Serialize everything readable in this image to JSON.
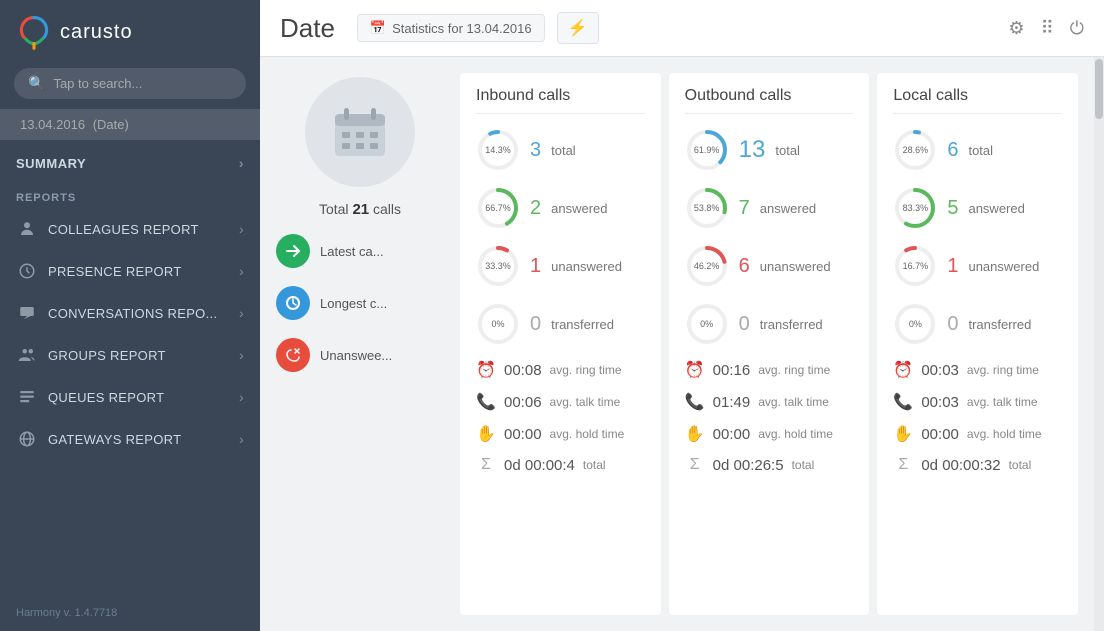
{
  "app": {
    "name": "carusto",
    "version": "Harmony v. 1.4.7718"
  },
  "sidebar": {
    "search_placeholder": "Tap to search...",
    "date_item": "13.04.2016",
    "date_label": "(Date)",
    "summary_label": "SUMMARY",
    "reports_label": "REPORTS",
    "nav_items": [
      {
        "id": "colleagues",
        "label": "COLLEAGUES REPORT",
        "icon": "person"
      },
      {
        "id": "presence",
        "label": "PRESENCE REPORT",
        "icon": "clock"
      },
      {
        "id": "conversations",
        "label": "CONVERSATIONS REPO...",
        "icon": "chat"
      },
      {
        "id": "groups",
        "label": "GROUPS REPORT",
        "icon": "groups"
      },
      {
        "id": "queues",
        "label": "QUEUES REPORT",
        "icon": "queues"
      },
      {
        "id": "gateways",
        "label": "GATEWAYS REPORT",
        "icon": "globe"
      }
    ]
  },
  "header": {
    "title": "Date",
    "stats_badge": "Statistics for 13.04.2016"
  },
  "left_panel": {
    "total_calls": "Total",
    "total_number": "21",
    "total_suffix": "calls",
    "items": [
      {
        "label": "Latest ca...",
        "color": "#27ae60",
        "bg": "#27ae60",
        "icon": "→"
      },
      {
        "label": "Longest c...",
        "color": "#3498db",
        "bg": "#3498db",
        "icon": "↺"
      },
      {
        "label": "Unanswee...",
        "color": "#e74c3c",
        "bg": "#e74c3c",
        "icon": "✗"
      }
    ]
  },
  "inbound": {
    "title": "Inbound calls",
    "total": {
      "pct": "14.3%",
      "value": "3",
      "label": "total",
      "color_blue": "#4da6d8",
      "seg": 14.3
    },
    "answered": {
      "pct": "66.7%",
      "value": "2",
      "label": "answered",
      "color_green": "#5cb85c",
      "seg": 66.7
    },
    "unanswered": {
      "pct": "33.3%",
      "value": "1",
      "label": "unanswered",
      "color_red": "#e05555",
      "seg": 33.3
    },
    "transferred": {
      "pct": "0%",
      "value": "0",
      "label": "transferred",
      "seg": 0
    },
    "avg_ring": "00:08",
    "avg_ring_label": "avg. ring time",
    "avg_talk": "00:06",
    "avg_talk_label": "avg. talk time",
    "avg_hold": "00:00",
    "avg_hold_label": "avg. hold time",
    "total_time": "0d 00:00:4",
    "total_time_label": "total"
  },
  "outbound": {
    "title": "Outbound calls",
    "total": {
      "pct": "61.9%",
      "value": "13",
      "label": "total",
      "seg": 61.9
    },
    "answered": {
      "pct": "53.8%",
      "value": "7",
      "label": "answered",
      "seg": 53.8
    },
    "unanswered": {
      "pct": "46.2%",
      "value": "6",
      "label": "unanswered",
      "seg": 46.2
    },
    "transferred": {
      "pct": "0%",
      "value": "0",
      "label": "transferred",
      "seg": 0
    },
    "avg_ring": "00:16",
    "avg_ring_label": "avg. ring time",
    "avg_talk": "01:49",
    "avg_talk_label": "avg. talk time",
    "avg_hold": "00:00",
    "avg_hold_label": "avg. hold time",
    "total_time": "0d 00:26:5",
    "total_time_label": "total"
  },
  "local": {
    "title": "Local calls",
    "total": {
      "pct": "28.6%",
      "value": "6",
      "label": "total",
      "seg": 28.6
    },
    "answered": {
      "pct": "83.3%",
      "value": "5",
      "label": "answered",
      "seg": 83.3
    },
    "unanswered": {
      "pct": "16.7%",
      "value": "1",
      "label": "unanswered",
      "seg": 16.7
    },
    "transferred": {
      "pct": "0%",
      "value": "0",
      "label": "transferred",
      "seg": 0
    },
    "avg_ring": "00:03",
    "avg_ring_label": "avg. ring time",
    "avg_talk": "00:03",
    "avg_talk_label": "avg. talk time",
    "avg_hold": "00:00",
    "avg_hold_label": "avg. hold time",
    "total_time": "0d 00:00:32",
    "total_time_label": "total"
  }
}
